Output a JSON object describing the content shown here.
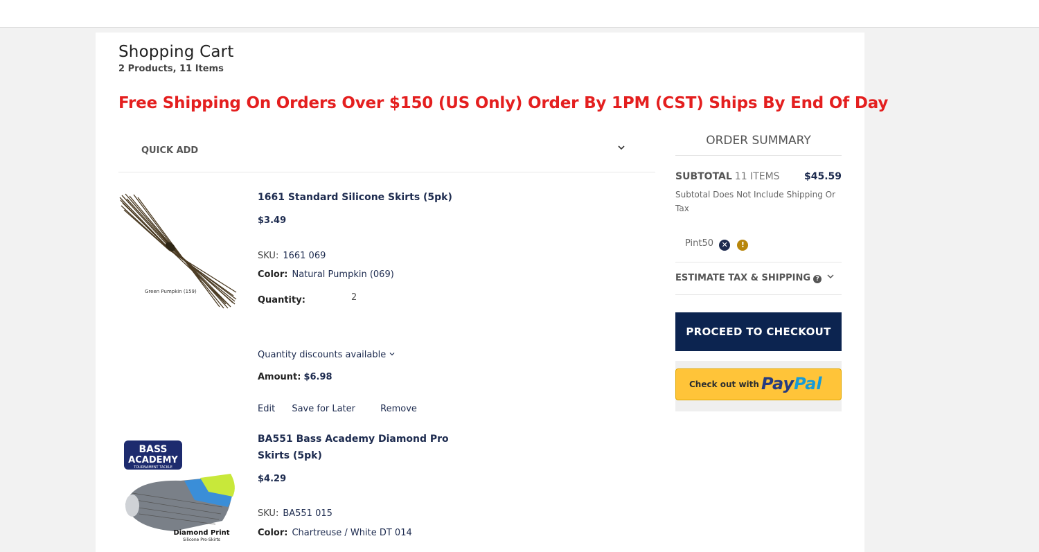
{
  "cart": {
    "title": "Shopping Cart",
    "count": "2 Products, 11 Items"
  },
  "promo": "Free Shipping On Orders Over $150 (US Only) Order By 1PM (CST) Ships By End Of Day",
  "quick_add": {
    "label": "QUICK ADD"
  },
  "labels": {
    "sku": "SKU:",
    "color": "Color:",
    "quantity": "Quantity:",
    "amount": "Amount:",
    "discount": "Quantity discounts available",
    "edit": "Edit",
    "save_later": "Save for Later",
    "remove": "Remove"
  },
  "items": [
    {
      "name": "1661 Standard Silicone Skirts (5pk)",
      "price": "$3.49",
      "sku": "1661 069",
      "color": "Natural Pumpkin (069)",
      "quantity": "2",
      "amount": "$6.98",
      "image_caption": "Green Pumpkin (159)"
    },
    {
      "name": "BA551 Bass Academy Diamond Pro Skirts (5pk)",
      "price": "$4.29",
      "sku": "BA551 015",
      "color": "Chartreuse / White DT 014",
      "logo_line1": "BASS",
      "logo_line2": "ACADEMY",
      "logo_line3": "TOURNAMENT TACKLE",
      "image_caption": "Diamond Print",
      "image_caption2": "Silicone Pro-Skirts"
    }
  ],
  "summary": {
    "title": "ORDER SUMMARY",
    "subtotal_label": "SUBTOTAL",
    "subtotal_items": "11 ITEMS",
    "subtotal_amount": "$45.59",
    "note": "Subtotal Does Not Include Shipping Or Tax",
    "coupon_code": "Pint50",
    "estimate_label": "ESTIMATE TAX & SHIPPING",
    "checkout_label": "PROCEED TO CHECKOUT",
    "paypal_text": "Check out with",
    "paypal_logo_pay": "Pay",
    "paypal_logo_pal": "Pal"
  },
  "colors": {
    "promo_red": "#e41f1f",
    "navy": "#0c2450",
    "paypal_yellow": "#ffc439"
  }
}
